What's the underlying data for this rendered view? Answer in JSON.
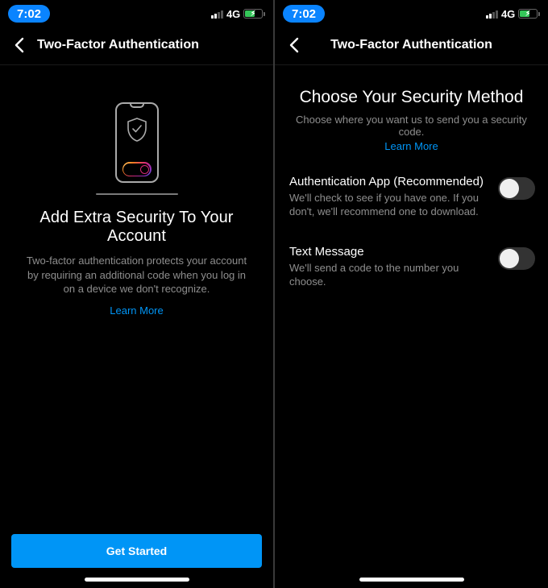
{
  "status": {
    "time": "7:02",
    "network": "4G"
  },
  "leftScreen": {
    "title": "Two-Factor Authentication",
    "headline": "Add Extra Security To Your Account",
    "body": "Two-factor authentication protects your account by requiring an additional code when you log in on a device we don't recognize.",
    "learnMore": "Learn More",
    "cta": "Get Started"
  },
  "rightScreen": {
    "title": "Two-Factor Authentication",
    "heading": "Choose Your Security Method",
    "sub": "Choose where you want us to send you a security code.",
    "learnMore": "Learn More",
    "options": [
      {
        "title": "Authentication App (Recommended)",
        "desc": "We'll check to see if you have one. If you don't, we'll recommend one to download.",
        "on": false
      },
      {
        "title": "Text Message",
        "desc": "We'll send a code to the number you choose.",
        "on": false
      }
    ]
  }
}
